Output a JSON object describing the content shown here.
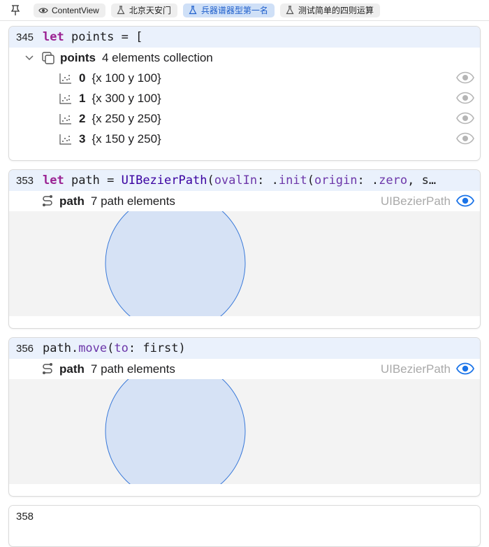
{
  "tabs": [
    {
      "label": "ContentView",
      "icon": "eye-icon",
      "active": false
    },
    {
      "label": "北京天安门",
      "icon": "flask-icon",
      "active": false
    },
    {
      "label": "兵器谱器型第一名",
      "icon": "flask-icon",
      "active": true
    },
    {
      "label": "测试简单的四则运算",
      "icon": "flask-icon",
      "active": false
    }
  ],
  "card1": {
    "line_number": "345",
    "code_kw": "let",
    "code_rest": " points = [",
    "collection": {
      "name": "points",
      "description": "4 elements collection"
    },
    "items": [
      {
        "index": "0",
        "value": "{x 100 y 100}"
      },
      {
        "index": "1",
        "value": "{x 300 y 100}"
      },
      {
        "index": "2",
        "value": "{x 250 y 250}"
      },
      {
        "index": "3",
        "value": "{x 150 y 250}"
      }
    ]
  },
  "card2": {
    "line_number": "353",
    "code_kw": "let",
    "code_mid1": " path = ",
    "code_type": "UIBezierPath",
    "code_mid2": "(",
    "code_fn1": "ovalIn",
    "code_mid3": ": .",
    "code_fn2": "init",
    "code_mid4": "(",
    "code_fn3": "origin",
    "code_mid5": ": .",
    "code_fn4": "zero",
    "code_mid6": ", s…",
    "result": {
      "name": "path",
      "description": "7 path elements",
      "type": "UIBezierPath"
    }
  },
  "card3": {
    "line_number": "356",
    "code_a": "path.",
    "code_fn1": "move",
    "code_b": "(",
    "code_fn2": "to",
    "code_c": ": first)",
    "result": {
      "name": "path",
      "description": "7 path elements",
      "type": "UIBezierPath"
    }
  },
  "card4": {
    "line_number": "358"
  },
  "colors": {
    "accent": "#1a73e8",
    "code_bg": "#eaf1fc",
    "keyword": "#9b2393",
    "shape_fill": "#d6e2f5",
    "shape_stroke": "#3b7ad9"
  }
}
